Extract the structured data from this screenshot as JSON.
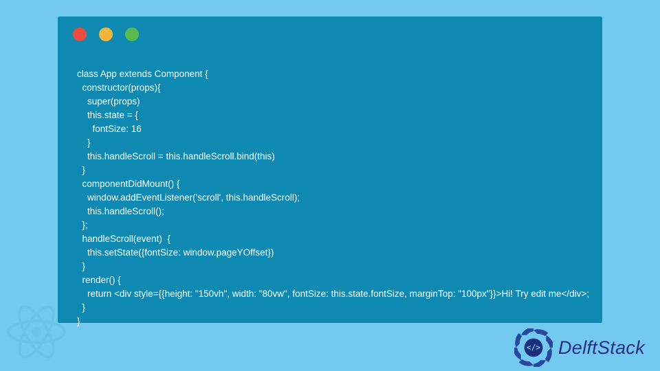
{
  "code": {
    "lines": [
      "class App extends Component {",
      "  constructor(props){",
      "    super(props)",
      "    this.state = {",
      "      fontSize: 16",
      "    }",
      "    this.handleScroll = this.handleScroll.bind(this)",
      "  }",
      "  componentDidMount() {",
      "    window.addEventListener('scroll', this.handleScroll);",
      "    this.handleScroll();",
      "  };",
      "  handleScroll(event)  {",
      "    this.setState({fontSize: window.pageYOffset})",
      "  }",
      "  render() {",
      "    return <div style={{height: \"150vh\", width: \"80vw\", fontSize: this.state.fontSize, marginTop: \"100px\"}}>Hi! Try edit me</div>;",
      "  }",
      "}"
    ]
  },
  "brand": {
    "name": "DelftStack"
  },
  "window": {
    "traffic_colors": [
      "#e94d3f",
      "#f0b63c",
      "#58ba4c"
    ]
  }
}
